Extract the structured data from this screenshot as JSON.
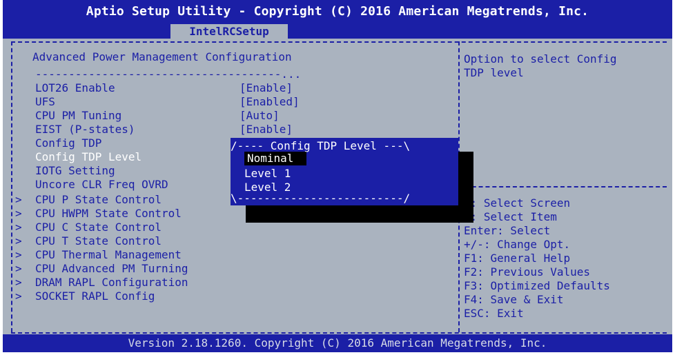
{
  "header": {
    "title": "Aptio Setup Utility - Copyright (C) 2016 American Megatrends, Inc.",
    "tab": "IntelRCSetup"
  },
  "footer": {
    "text": "Version 2.18.1260. Copyright (C) 2016 American Megatrends, Inc."
  },
  "main": {
    "title": "Advanced Power Management Configuration",
    "divider": "-------------------------------------...",
    "items": [
      {
        "label": "LOT26 Enable",
        "value": "[Enable]"
      },
      {
        "label": "UFS",
        "value": "[Enabled]"
      },
      {
        "label": "CPU PM Tuning",
        "value": "[Auto]"
      },
      {
        "label": "EIST (P-states)",
        "value": "[Enable]"
      },
      {
        "label": "Config TDP",
        "value": ""
      },
      {
        "label": "Config TDP Level",
        "value": ""
      },
      {
        "label": "IOTG Setting",
        "value": ""
      },
      {
        "label": "Uncore CLR Freq OVRD",
        "value": ""
      }
    ],
    "submenus": [
      "CPU P State Control",
      "CPU HWPM State Control",
      "CPU C State Control",
      "CPU T State Control",
      "CPU Thermal Management",
      "CPU Advanced PM Turning",
      "DRAM RAPL Configuration",
      "SOCKET RAPL Config"
    ]
  },
  "help": {
    "description": [
      "Option to select Config",
      "TDP level"
    ],
    "keys": [
      "<: Select Screen",
      "v: Select Item",
      "Enter: Select",
      "+/-: Change Opt.",
      "F1: General Help",
      "F2: Previous Values",
      "F3: Optimized Defaults",
      "F4: Save & Exit",
      "ESC: Exit"
    ]
  },
  "popup": {
    "title": "/---- Config TDP Level ---\\",
    "options": [
      "Nominal",
      "Level 1",
      "Level 2"
    ],
    "bottom": "\\-------------------------/"
  }
}
